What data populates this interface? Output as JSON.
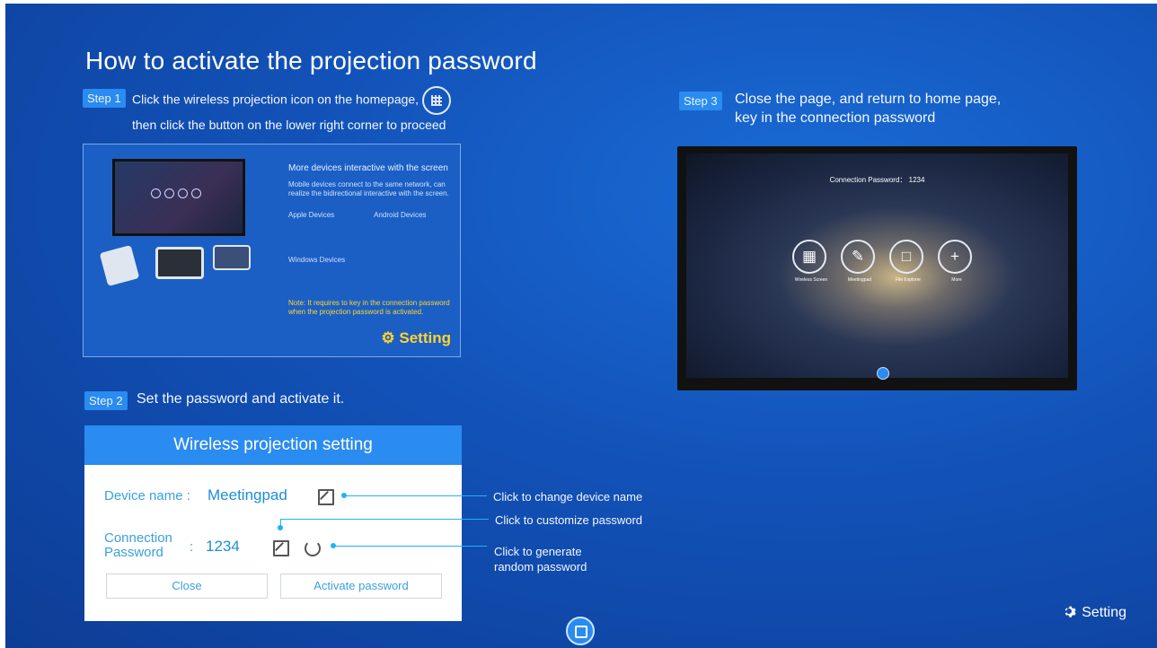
{
  "title": "How to activate the projection password",
  "step1": {
    "badge": "Step 1",
    "line1": "Click the wireless projection icon on the homepage,",
    "line2": "then click the button on the lower right corner to proceed",
    "preview": {
      "heading": "More devices interactive with the screen",
      "sub": "Mobile devices connect to the same network, can realize the bidirectional interactive with the screen.",
      "apple": "Apple Devices",
      "android": "Android Devices",
      "windows": "Windows Devices",
      "note": "Note: It requires to key in the connection password when the projection password is activated.",
      "setting": "Setting"
    }
  },
  "step2": {
    "badge": "Step 2",
    "text": "Set the password and activate it.",
    "dialog": {
      "title": "Wireless projection setting",
      "device_label": "Device name :",
      "device_value": "Meetingpad",
      "password_label_1": "Connection",
      "password_label_2": "Password",
      "password_colon": ":",
      "password_value": "1234",
      "close": "Close",
      "activate": "Activate password"
    },
    "callouts": {
      "change_name": "Click to change device name",
      "customize": "Click to customize password",
      "random_1": "Click to generate",
      "random_2": "random password"
    }
  },
  "step3": {
    "badge": "Step 3",
    "line1": "Close the page, and return to home page,",
    "line2": "key in the connection password",
    "screen": {
      "connection": "Connection Password： 1234",
      "apps": [
        "Wireless Screen",
        "Meetingpad",
        "File Explorer",
        "More"
      ]
    }
  },
  "bottom": {
    "setting": "Setting"
  },
  "colors": {
    "accent": "#2a8bf0",
    "highlight": "#ffd42a",
    "connector": "#1fb3f5"
  }
}
